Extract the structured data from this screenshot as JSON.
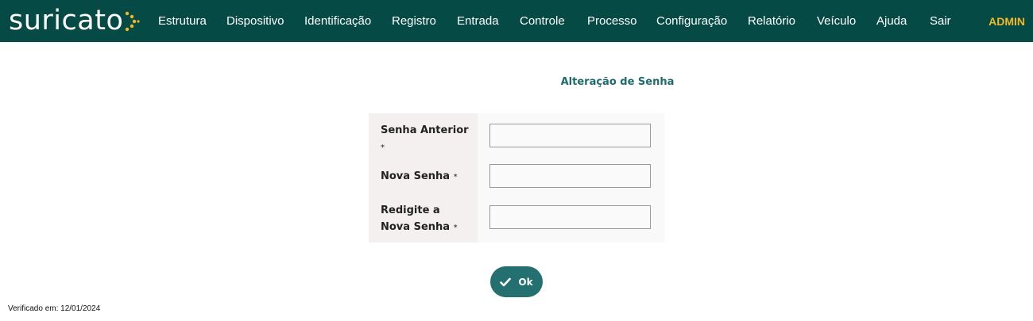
{
  "app": {
    "logo_text": "suricato",
    "logo_dot_color": "#f2b824"
  },
  "nav": {
    "items": [
      {
        "label": "Estrutura"
      },
      {
        "label": "Dispositivo"
      },
      {
        "label": "Identificação"
      },
      {
        "label": "Registro"
      },
      {
        "label": "Entrada"
      },
      {
        "label": "Controle"
      },
      {
        "label": "Processo"
      },
      {
        "label": "Configuração"
      },
      {
        "label": "Relatório"
      },
      {
        "label": "Veículo"
      },
      {
        "label": "Ajuda"
      },
      {
        "label": "Sair"
      }
    ],
    "user": "ADMIN"
  },
  "page": {
    "title": "Alteração de Senha"
  },
  "form": {
    "fields": [
      {
        "label": "Senha Anterior",
        "required_mark": "*",
        "value": ""
      },
      {
        "label": "Nova Senha",
        "required_mark": "*",
        "value": ""
      },
      {
        "label": "Redigite a Nova Senha",
        "required_mark": "*",
        "value": ""
      }
    ],
    "ok_label": "Ok"
  },
  "footer": {
    "verified": "Verificado em: 12/01/2024"
  },
  "colors": {
    "topbar": "#064a45",
    "accent": "#246f70",
    "title": "#1e6b6e",
    "user": "#f2b824"
  }
}
